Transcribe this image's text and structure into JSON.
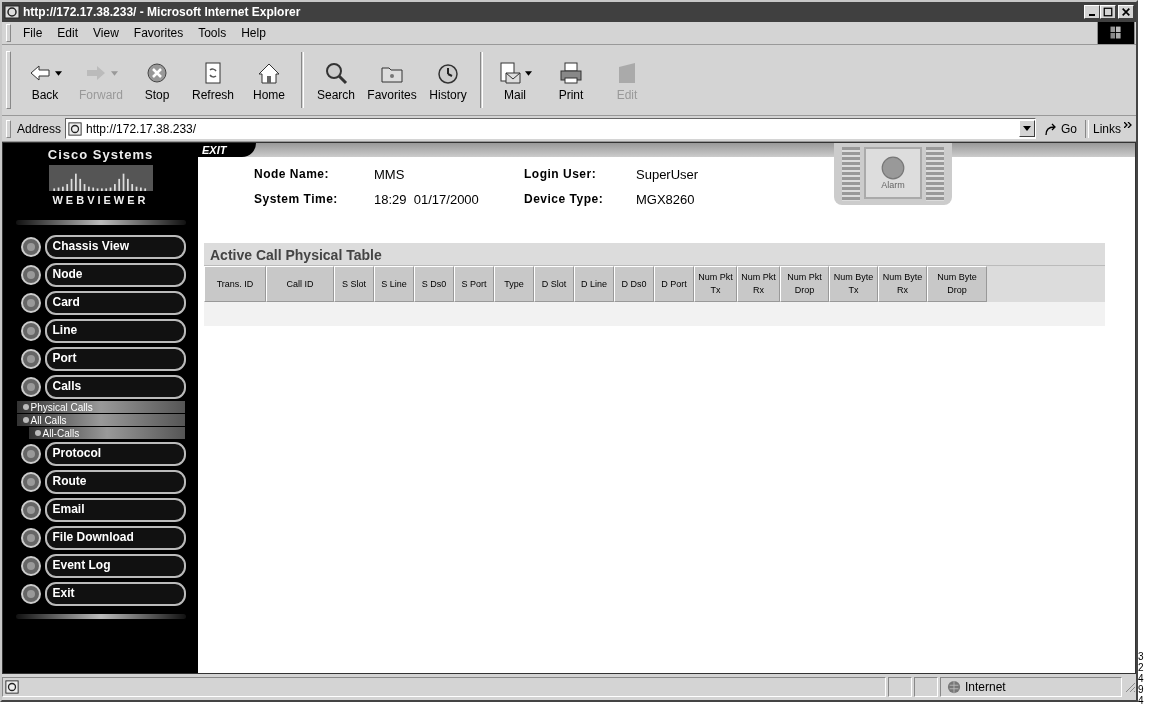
{
  "window": {
    "title": "http://172.17.38.233/ - Microsoft Internet Explorer"
  },
  "menu": [
    "File",
    "Edit",
    "View",
    "Favorites",
    "Tools",
    "Help"
  ],
  "toolbar": [
    {
      "label": "Back",
      "disabled": false,
      "dropdown": true
    },
    {
      "label": "Forward",
      "disabled": true,
      "dropdown": true
    },
    {
      "label": "Stop",
      "disabled": false,
      "dropdown": false
    },
    {
      "label": "Refresh",
      "disabled": false,
      "dropdown": false
    },
    {
      "label": "Home",
      "disabled": false,
      "dropdown": false
    },
    {
      "label": "Search",
      "disabled": false,
      "dropdown": false
    },
    {
      "label": "Favorites",
      "disabled": false,
      "dropdown": false
    },
    {
      "label": "History",
      "disabled": false,
      "dropdown": false
    },
    {
      "label": "Mail",
      "disabled": false,
      "dropdown": true
    },
    {
      "label": "Print",
      "disabled": false,
      "dropdown": false
    },
    {
      "label": "Edit",
      "disabled": true,
      "dropdown": false
    }
  ],
  "address": {
    "label": "Address",
    "value": "http://172.17.38.233/",
    "go": "Go",
    "links": "Links"
  },
  "logo": {
    "brand": "Cisco Systems",
    "product": "WEBVIEWER"
  },
  "nav": [
    {
      "label": "Chassis View"
    },
    {
      "label": "Node"
    },
    {
      "label": "Card"
    },
    {
      "label": "Line"
    },
    {
      "label": "Port"
    },
    {
      "label": "Calls",
      "children": [
        {
          "label": "Physical Calls"
        },
        {
          "label": "All Calls",
          "children": [
            {
              "label": "All-Calls"
            }
          ]
        }
      ]
    },
    {
      "label": "Protocol"
    },
    {
      "label": "Route"
    },
    {
      "label": "Email"
    },
    {
      "label": "File Download"
    },
    {
      "label": "Event Log"
    },
    {
      "label": "Exit"
    }
  ],
  "header": {
    "exit": "EXIT",
    "fields": [
      {
        "label": "Node Name:",
        "value": "MMS"
      },
      {
        "label": "Login User:",
        "value": "SuperUser"
      },
      {
        "label": "System Time:",
        "value": "18:29  01/17/2000"
      },
      {
        "label": "Device Type:",
        "value": "MGX8260"
      }
    ],
    "alarm": "Alarm"
  },
  "table": {
    "title": "Active Call Physical Table",
    "columns": [
      "Trans. ID",
      "Call ID",
      "S Slot",
      "S Line",
      "S Ds0",
      "S Port",
      "Type",
      "D Slot",
      "D Line",
      "D Ds0",
      "D Port",
      "Num Pkt\nTx",
      "Num Pkt\nRx",
      "Num Pkt\nDrop",
      "Num Byte\nTx",
      "Num Byte\nRx",
      "Num Byte\nDrop"
    ]
  },
  "status_bar": {
    "zone": "Internet"
  },
  "figure_number": "32494"
}
